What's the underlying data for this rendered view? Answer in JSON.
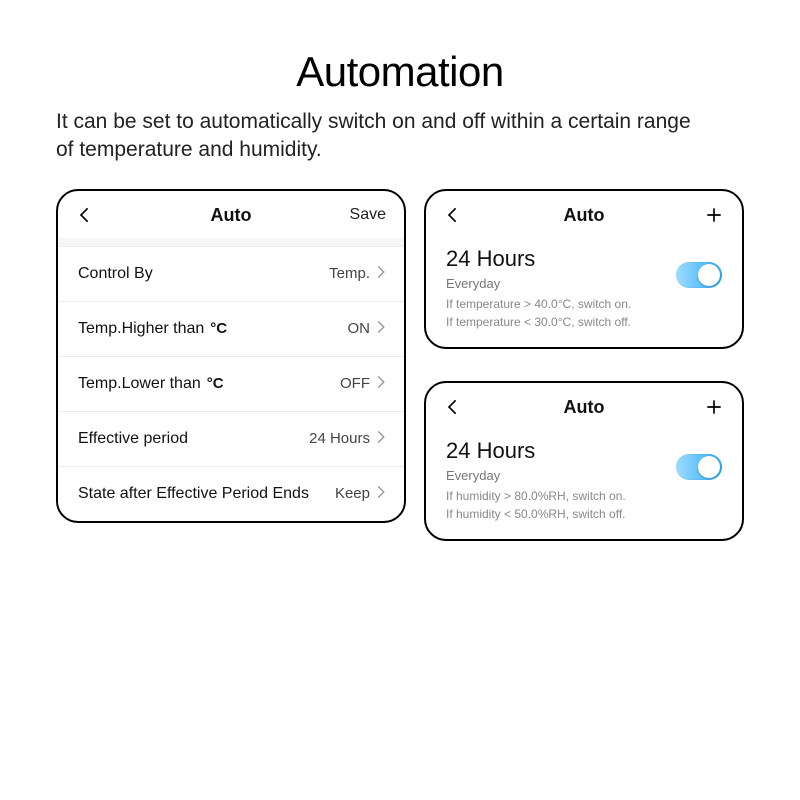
{
  "header": {
    "title": "Automation",
    "subtitle": "It can be set to automatically switch on and off within a certain range of temperature and humidity."
  },
  "settings_card": {
    "header": {
      "title": "Auto",
      "action": "Save"
    },
    "rows": [
      {
        "label": "Control By",
        "value": "Temp."
      },
      {
        "label": "Temp.Higher than",
        "unit": "°C",
        "value": "ON"
      },
      {
        "label": "Temp.Lower than",
        "unit": "°C",
        "value": "OFF"
      },
      {
        "label": "Effective period",
        "value": "24 Hours"
      },
      {
        "label": "State after Effective Period Ends",
        "value": "Keep"
      }
    ]
  },
  "rule_cards": [
    {
      "header_title": "Auto",
      "title": "24 Hours",
      "subtitle": "Everyday",
      "line1": "If temperature > 40.0°C, switch on.",
      "line2": "If temperature < 30.0°C, switch off.",
      "toggle": true
    },
    {
      "header_title": "Auto",
      "title": "24 Hours",
      "subtitle": "Everyday",
      "line1": "If humidity > 80.0%RH, switch on.",
      "line2": "If humidity < 50.0%RH, switch off.",
      "toggle": true
    }
  ]
}
